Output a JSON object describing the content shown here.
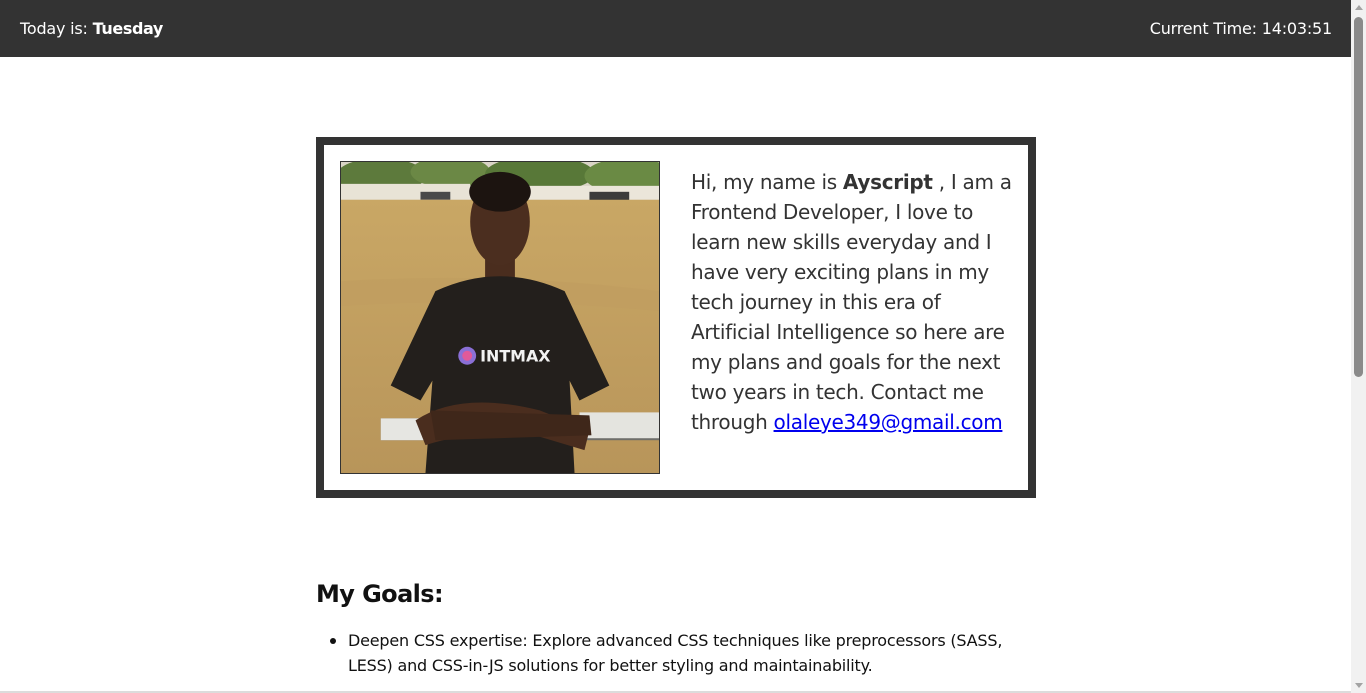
{
  "header": {
    "day_label": "Today is: ",
    "day_value": "Tuesday",
    "time_label": "Current Time: ",
    "time_value": "14:03:51"
  },
  "profile": {
    "photo_icon": "profile-photo",
    "shirt_text": "INTMAX",
    "bio_prefix": "Hi, my name is ",
    "name": "Ayscript",
    "bio_body": " , I am a Frontend Developer, I love to learn new skills everyday and I have very exciting plans in my tech journey in this era of Artificial Intelligence so here are my plans and goals for the next two years in tech. Contact me through ",
    "email": "olaleye349@gmail.com"
  },
  "goals": {
    "heading": "My Goals:",
    "items": [
      "Deepen CSS expertise: Explore advanced CSS techniques like preprocessors (SASS, LESS) and CSS-in-JS solutions for better styling and maintainability."
    ]
  },
  "colors": {
    "header_bg": "#333333",
    "card_border": "#333333",
    "link": "#0000ee"
  }
}
